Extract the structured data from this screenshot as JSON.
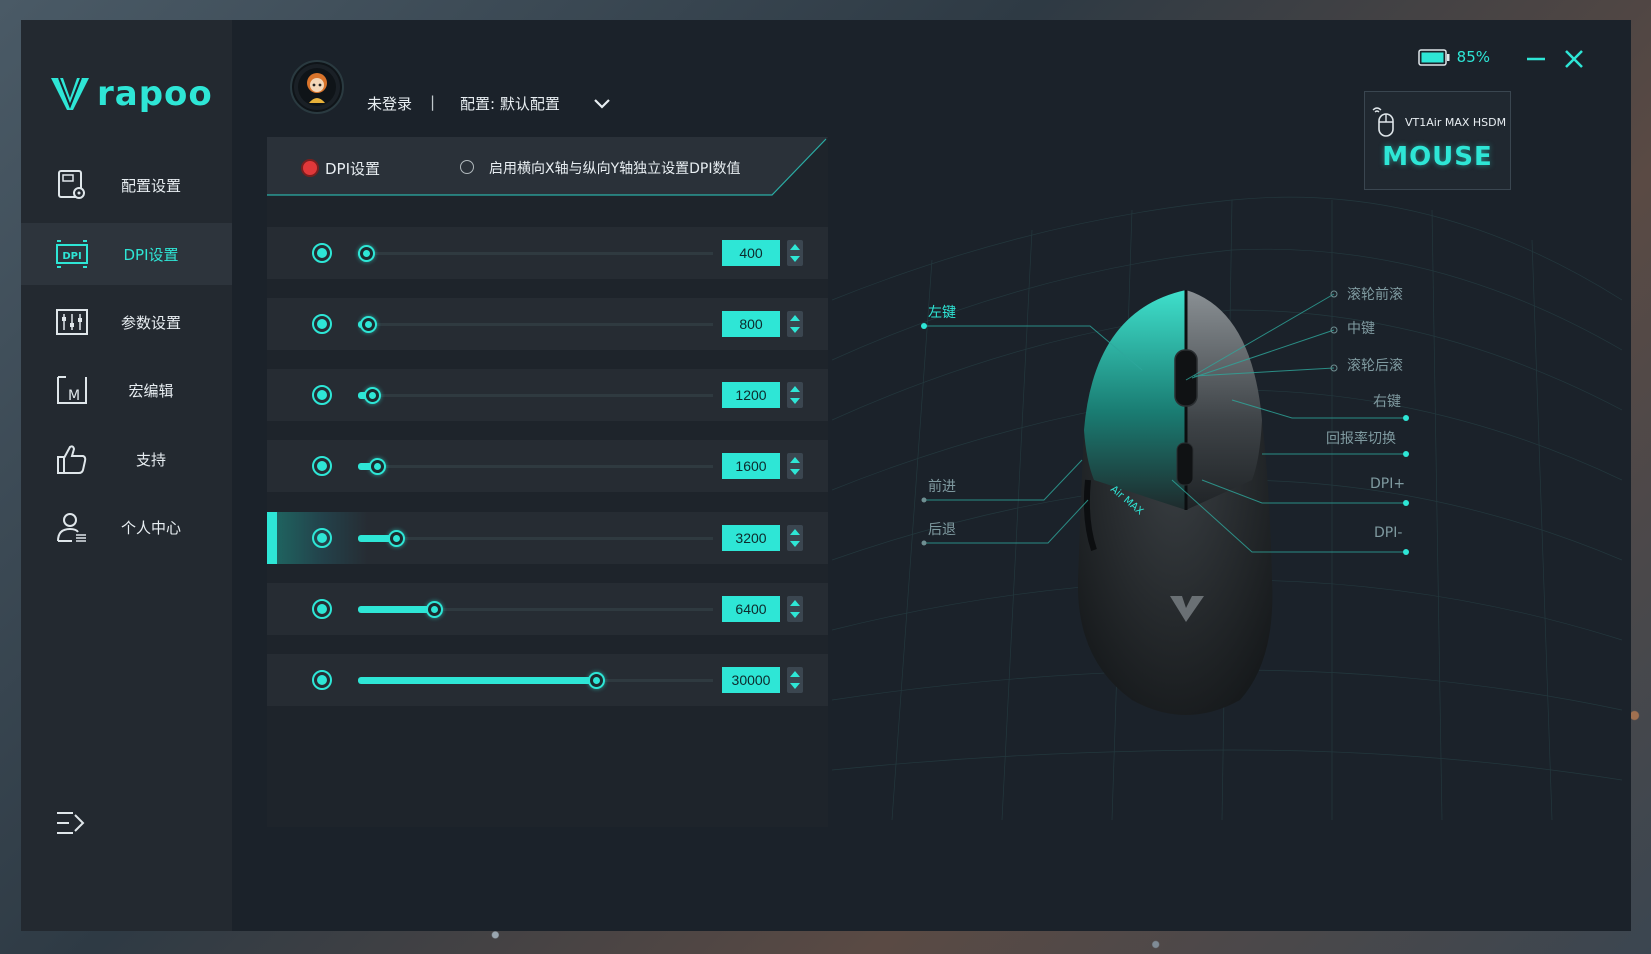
{
  "app": {
    "brand": "rapoo",
    "battery_percent": "85%",
    "accent_color": "#2ee6d6"
  },
  "sidebar": {
    "items": [
      {
        "label": "配置设置",
        "icon": "profile-settings-icon"
      },
      {
        "label": "DPI设置",
        "icon": "dpi-icon",
        "active": true
      },
      {
        "label": "参数设置",
        "icon": "sliders-icon"
      },
      {
        "label": "宏编辑",
        "icon": "macro-icon"
      },
      {
        "label": "支持",
        "icon": "thumbs-up-icon"
      },
      {
        "label": "个人中心",
        "icon": "user-center-icon"
      }
    ]
  },
  "header": {
    "login_status": "未登录",
    "separator": "|",
    "profile_label": "配置: 默认配置"
  },
  "device": {
    "name": "VT1Air MAX HSDM",
    "type": "MOUSE"
  },
  "dpi_panel": {
    "title": "DPI设置",
    "xy_option_label": "启用横向X轴与纵向Y轴独立设置DPI数值",
    "xy_enabled": false,
    "max_dpi": 30000,
    "levels": [
      {
        "value": "400",
        "fraction": 0.013
      },
      {
        "value": "800",
        "fraction": 0.027
      },
      {
        "value": "1200",
        "fraction": 0.04
      },
      {
        "value": "1600",
        "fraction": 0.053
      },
      {
        "value": "3200",
        "fraction": 0.107,
        "active": true
      },
      {
        "value": "6400",
        "fraction": 0.213
      },
      {
        "value": "30000",
        "fraction": 0.67
      }
    ]
  },
  "mouse_buttons": {
    "left": "左键",
    "forward": "前进",
    "back": "后退",
    "scroll_up": "滚轮前滚",
    "middle": "中键",
    "scroll_down": "滚轮后滚",
    "right": "右键",
    "report_rate": "回报率切换",
    "dpi_up": "DPI+",
    "dpi_down": "DPI-",
    "body_text": "Air MAX"
  }
}
